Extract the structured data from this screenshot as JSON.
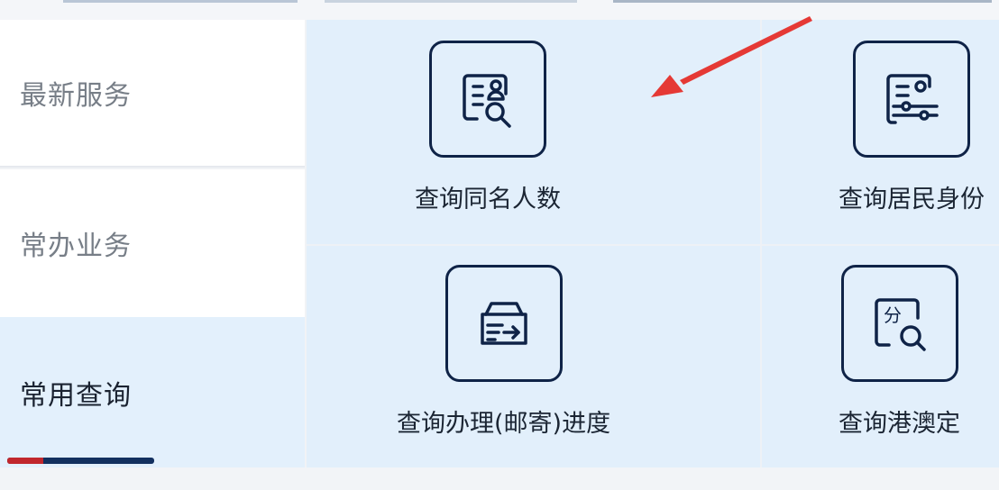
{
  "sidebar": {
    "items": [
      {
        "label": "最新服务"
      },
      {
        "label": "常办业务"
      },
      {
        "label": "常用查询",
        "active": true
      }
    ]
  },
  "grid": {
    "cells": [
      {
        "label": "查询同名人数",
        "icon": "person-document-search-icon"
      },
      {
        "label": "查询居民身份",
        "icon": "id-document-sliders-icon"
      },
      {
        "label": "查询办理(邮寄)进度",
        "icon": "mailbox-send-icon"
      },
      {
        "label": "查询港澳定",
        "icon": "document-split-search-icon"
      }
    ]
  },
  "colors": {
    "accent_navy": "#13305f",
    "accent_red": "#c1272d",
    "annotation_arrow": "#e53935",
    "grid_bg": "#e2effb"
  }
}
